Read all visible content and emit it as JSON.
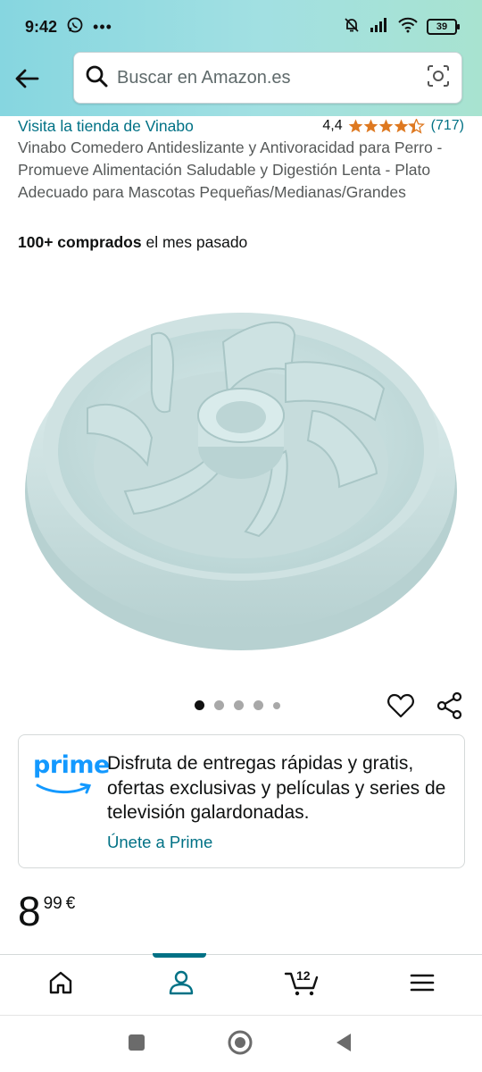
{
  "status_bar": {
    "time": "9:42",
    "battery": "39",
    "icons": [
      "whatsapp-icon",
      "more-notifications-icon",
      "mute-bell-icon",
      "signal-icon",
      "wifi-icon",
      "battery-icon"
    ]
  },
  "header": {
    "search_placeholder": "Buscar en Amazon.es",
    "icons": [
      "back-arrow-icon",
      "search-icon",
      "camera-lens-icon"
    ]
  },
  "product": {
    "store_link": "Visita la tienda de Vinabo",
    "rating_value": "4,4",
    "rating_stars": 4.4,
    "rating_count": "(717)",
    "title": "Vinabo Comedero Antideslizante y Antivoracidad para Perro - Promueve Alimentación Saludable y Digestión Lenta - Plato Adecuado para Mascotas Pequeñas/Medianas/Grandes",
    "bought_bold": "100+ comprados",
    "bought_rest": " el mes pasado",
    "image_count": 5,
    "image_selected": 1
  },
  "prime": {
    "logo": "prime",
    "text": "Disfruta de entregas rápidas y gratis, ofertas exclusivas y películas y series de televisión galardonadas.",
    "join": "Únete a Prime"
  },
  "price": {
    "whole": "8",
    "fraction": "99",
    "currency": "€"
  },
  "bottom_nav": {
    "items": [
      "home-icon",
      "account-icon",
      "cart-icon",
      "menu-icon"
    ],
    "active": "account-icon",
    "cart_count": "12"
  },
  "colors": {
    "header_gradient_start": "#86d6e0",
    "header_gradient_end": "#a8e3d0",
    "link": "#007185",
    "star": "#de7921",
    "prime_blue": "#1399ff",
    "bowl": "#cfe3e3"
  }
}
